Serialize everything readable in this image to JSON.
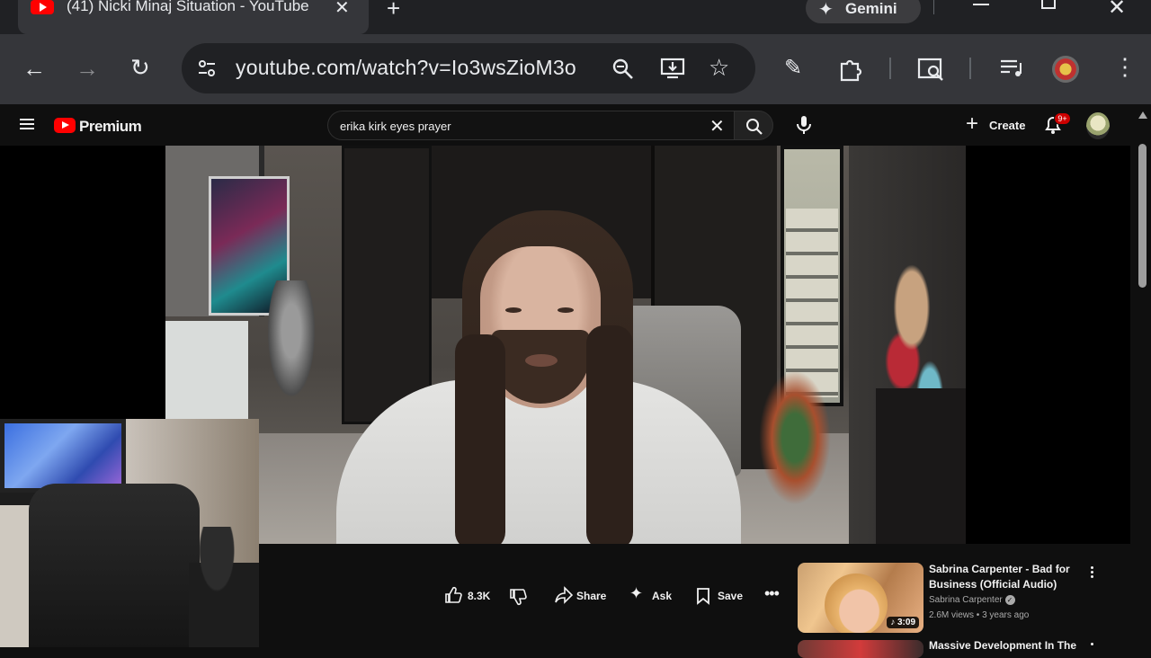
{
  "browser": {
    "tab_title": "(41) Nicki Minaj Situation - YouTube",
    "gemini_label": "Gemini",
    "url": "youtube.com/watch?v=Io3wsZioM3o"
  },
  "youtube": {
    "brand": "Premium",
    "search_query": "erika kirk eyes prayer",
    "create_label": "Create",
    "notification_count": "9+"
  },
  "actions": {
    "like_count": "8.3K",
    "share_label": "Share",
    "ask_label": "Ask",
    "save_label": "Save"
  },
  "recommendations": [
    {
      "title": "Sabrina Carpenter - Bad for Business (Official Audio)",
      "channel": "Sabrina Carpenter",
      "stats": "2.6M views • 3 years ago",
      "duration": "3:09"
    },
    {
      "title": "Massive Development In The"
    }
  ],
  "colors": {
    "youtube_red": "#ff0000",
    "background": "#0f0f0f",
    "badge_red": "#cc0000"
  }
}
